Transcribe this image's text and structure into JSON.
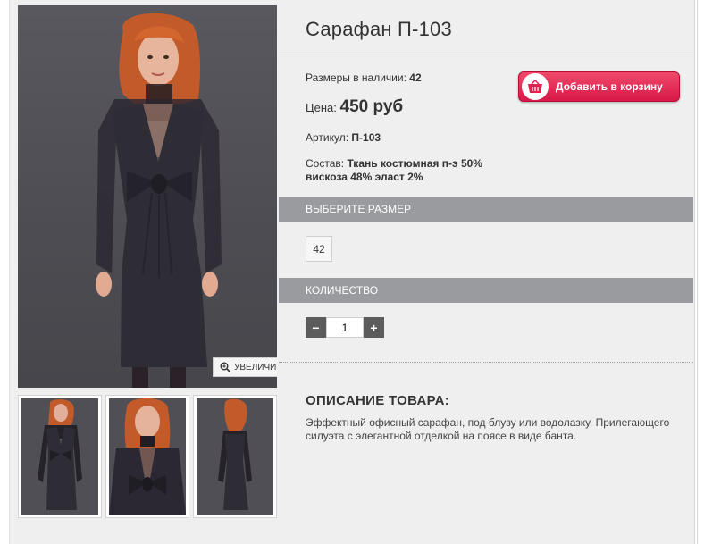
{
  "product": {
    "title": "Сарафан П-103",
    "sizes_label": "Размеры в наличии:",
    "sizes_value": "42",
    "price_label": "Цена:",
    "price_value": "450 руб",
    "sku_label": "Артикул:",
    "sku_value": "П-103",
    "composition_label": "Состав:",
    "composition_value": "Ткань костюмная п-э 50% вискоза 48% эласт 2%"
  },
  "cart_button": {
    "label": "Добавить в корзину",
    "icon": "basket-icon"
  },
  "zoom_button": {
    "label": "УВЕЛИЧИТЬ",
    "icon": "zoom-in-icon"
  },
  "size_section": {
    "title": "ВЫБЕРИТЕ РАЗМЕР",
    "options": [
      "42"
    ]
  },
  "quantity_section": {
    "title": "КОЛИЧЕСТВО",
    "minus": "−",
    "plus": "+",
    "value": "1"
  },
  "description": {
    "title": "ОПИСАНИЕ ТОВАРА:",
    "text": "Эффектный офисный сарафан, под блузу или водолазку. Прилегающего силуэта с элегантной отделкой на поясе в виде банта."
  },
  "colors": {
    "accent": "#e02452",
    "section_bar": "#9a9b9e",
    "panel": "#efefef",
    "dress": "#2c2b33",
    "hair": "#c35a2a"
  }
}
